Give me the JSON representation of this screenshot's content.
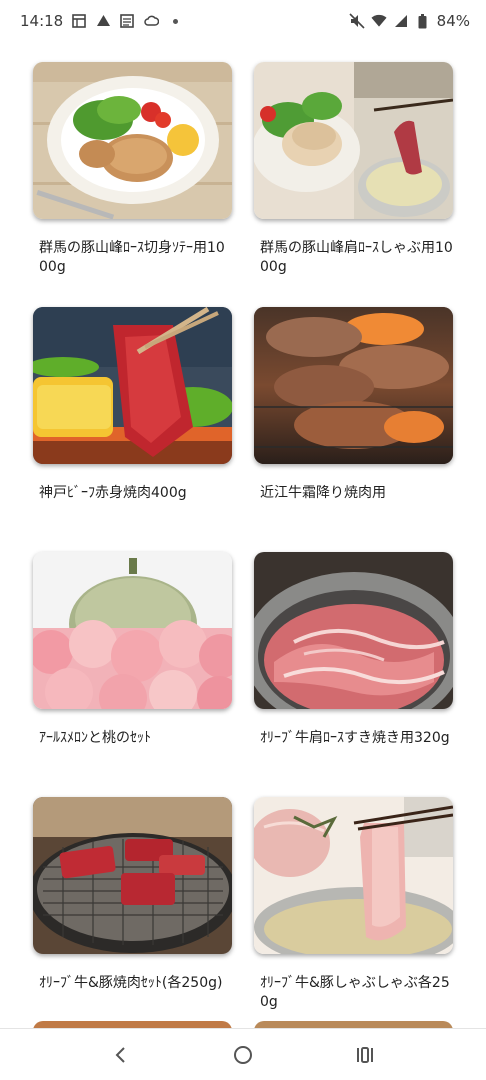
{
  "status_bar": {
    "time": "14:18",
    "battery_percent": "84%",
    "left_icons": [
      "calendar-icon",
      "drive-icon",
      "news-icon",
      "cloud-icon",
      "dot-icon"
    ],
    "right_icons": [
      "mute-icon",
      "wifi-icon",
      "signal-icon",
      "battery-icon"
    ]
  },
  "products": [
    {
      "title": "群馬の豚山峰ﾛｰｽ切身ｿﾃｰ用1000g"
    },
    {
      "title": "群馬の豚山峰肩ﾛｰｽしゃぶ用1000g"
    },
    {
      "title": "神戸ﾋﾞｰﾌ赤身焼肉400g"
    },
    {
      "title": "近江牛霜降り焼肉用"
    },
    {
      "title": "ｱｰﾙｽﾒﾛﾝと桃のｾｯﾄ"
    },
    {
      "title": "ｵﾘｰﾌﾞ牛肩ﾛｰｽすき焼き用320g"
    },
    {
      "title": "ｵﾘｰﾌﾞ牛&豚焼肉ｾｯﾄ(各250g)"
    },
    {
      "title": "ｵﾘｰﾌﾞ牛&豚しゃぶしゃぶ各250g"
    }
  ],
  "nav_bar": {
    "buttons": [
      "back-icon",
      "home-icon",
      "recents-icon"
    ]
  }
}
